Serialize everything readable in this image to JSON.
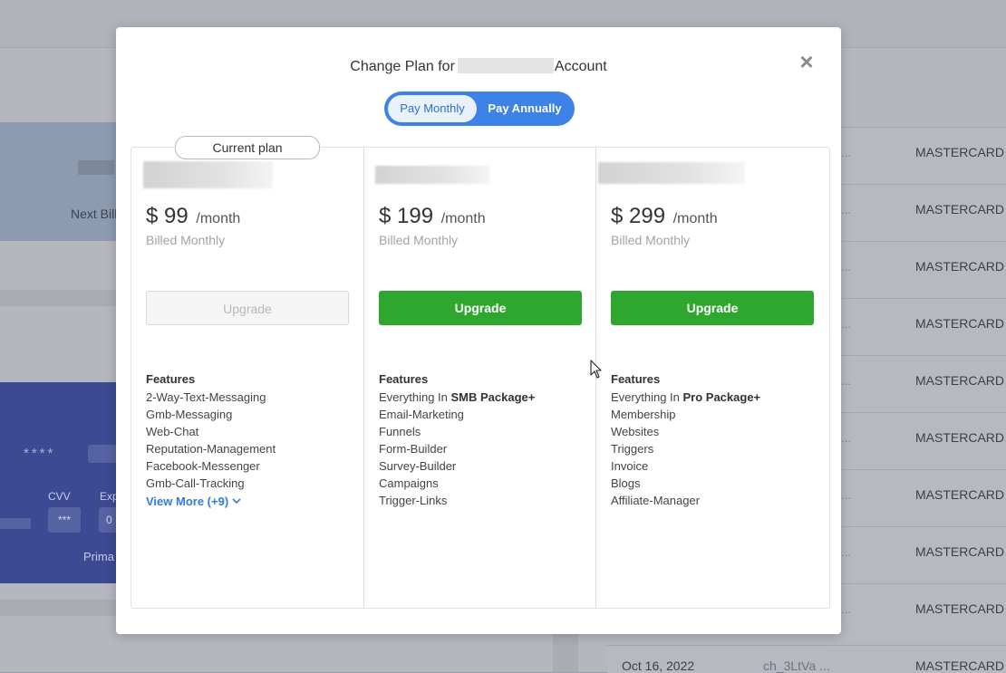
{
  "background": {
    "next_billing_label": "Next Bill",
    "card_stars": "****",
    "cvv_label": "CVV",
    "exp_label": "Exp",
    "cvv_value": "***",
    "exp_value": "0",
    "primary_label": "Prima",
    "table_rows": [
      {
        "ellipsis": "...",
        "method": "MASTERCARD •"
      },
      {
        "ellipsis": "...",
        "method": "MASTERCARD •"
      },
      {
        "ellipsis": "...",
        "method": "MASTERCARD •"
      },
      {
        "ellipsis": "...",
        "method": "MASTERCARD •"
      },
      {
        "ellipsis": "...",
        "method": "MASTERCARD •"
      },
      {
        "ellipsis": "...",
        "method": "MASTERCARD •"
      },
      {
        "ellipsis": "...",
        "method": "MASTERCARD •"
      },
      {
        "ellipsis": "...",
        "method": "MASTERCARD •"
      },
      {
        "ellipsis": "...",
        "method": "MASTERCARD •"
      }
    ],
    "last_row": {
      "date": "Oct 16, 2022",
      "charge": "ch_3LtVa ...",
      "method": "MASTERCARD •"
    }
  },
  "modal": {
    "title_prefix": "Change Plan for",
    "title_suffix": "Account",
    "close_glyph": "×",
    "billing_toggle": {
      "monthly": "Pay Monthly",
      "annually": "Pay Annually",
      "selected": "monthly"
    },
    "current_plan_badge": "Current plan",
    "plans": [
      {
        "price": "$ 99",
        "period": "/month",
        "billed": "Billed Monthly",
        "button": "Upgrade",
        "button_enabled": false,
        "features_heading": "Features",
        "features": [
          "2-Way-Text-Messaging",
          "Gmb-Messaging",
          "Web-Chat",
          "Reputation-Management",
          "Facebook-Messenger",
          "Gmb-Call-Tracking"
        ],
        "view_more": "View More (+9)"
      },
      {
        "price": "$ 199",
        "period": "/month",
        "billed": "Billed Monthly",
        "button": "Upgrade",
        "button_enabled": true,
        "features_heading": "Features",
        "features_intro": {
          "prefix": "Everything In",
          "bold": "SMB Package+"
        },
        "features": [
          "Email-Marketing",
          "Funnels",
          "Form-Builder",
          "Survey-Builder",
          "Campaigns",
          "Trigger-Links"
        ]
      },
      {
        "price": "$ 299",
        "period": "/month",
        "billed": "Billed Monthly",
        "button": "Upgrade",
        "button_enabled": true,
        "features_heading": "Features",
        "features_intro": {
          "prefix": "Everything In",
          "bold": "Pro Package+"
        },
        "features": [
          "Membership",
          "Websites",
          "Triggers",
          "Invoice",
          "Blogs",
          "Affiliate-Manager"
        ]
      }
    ]
  },
  "colors": {
    "toggle_accent": "#3d82e6",
    "upgrade_green": "#2fa72f",
    "link_blue": "#2f7be0"
  }
}
